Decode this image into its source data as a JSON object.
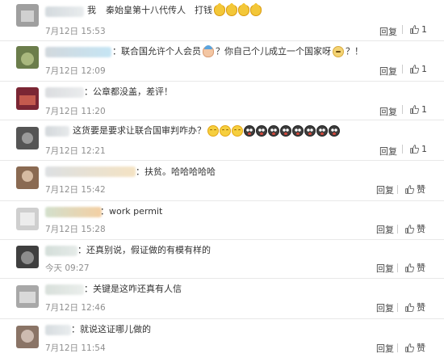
{
  "comments": [
    {
      "text_prefix": "我",
      "text": "秦始皇第十八代传人　打钱",
      "emojis": [
        "cat",
        "cat",
        "cat",
        "cat"
      ],
      "time": "7月12日 15:53",
      "reply_label": "回复",
      "like_count": "1",
      "avatar_colors": [
        "#9f9f9f",
        "#d0d0d0"
      ],
      "name_colors": [
        "#c9d1d6",
        "#e4e8ea"
      ]
    },
    {
      "text": "：联合国允许个人会员",
      "text_after": "？你自己个儿成立一个国家呀",
      "text_end": "？！",
      "emoji_mid": "baby",
      "emoji_end": "doge",
      "time": "7月12日 12:09",
      "reply_label": "回复",
      "like_count": "1",
      "avatar_colors": [
        "#6b7d4b",
        "#a9b87e"
      ],
      "name_colors": [
        "#c7cfd5",
        "#b8dff2"
      ]
    },
    {
      "text": "：公章都没盖，差评！",
      "time": "7月12日 11:20",
      "reply_label": "回复",
      "like_count": "1",
      "avatar_colors": [
        "#7b2634",
        "#c45a4e"
      ],
      "name_colors": [
        "#d2d5d8",
        "#e6e8ea"
      ]
    },
    {
      "text": "这货要是要求让联合国审判咋办？",
      "emojis": [
        "laugh",
        "laugh",
        "laugh",
        "shock",
        "shock",
        "shock",
        "shock",
        "shock",
        "shock",
        "shock",
        "shock"
      ],
      "time": "7月12日 12:21",
      "reply_label": "回复",
      "like_count": "1",
      "avatar_colors": [
        "#555555",
        "#9b9b9b"
      ],
      "name_colors": [
        "#c9cfd3",
        "#e2e5e7"
      ]
    },
    {
      "text": "：扶贫。哈哈哈哈哈",
      "time": "7月12日 15:42",
      "reply_label": "回复",
      "like_label": "赞",
      "avatar_colors": [
        "#8a6a52",
        "#d6bba2"
      ],
      "name_colors": [
        "#d5d9dc",
        "#f2dcb5"
      ]
    },
    {
      "text": "：work permit",
      "time": "7月12日 15:28",
      "reply_label": "回复",
      "like_label": "赞",
      "avatar_colors": [
        "#cfcfcf",
        "#ececec"
      ],
      "name_colors": [
        "#c8d8c0",
        "#f1c48d"
      ]
    },
    {
      "text": "：还真别说，假证做的有模有样的",
      "time": "今天 09:27",
      "reply_label": "回复",
      "like_label": "赞",
      "avatar_colors": [
        "#3f3f3f",
        "#8d8d8d"
      ],
      "name_colors": [
        "#c9d6d0",
        "#e0e7e4"
      ]
    },
    {
      "text": "：关键是这咋还真有人信",
      "time": "7月12日 12:46",
      "reply_label": "回复",
      "like_label": "赞",
      "avatar_colors": [
        "#a8a8a8",
        "#d9d9d9"
      ],
      "name_colors": [
        "#cfd8d2",
        "#e6ebe8"
      ]
    },
    {
      "text": "：就说这证哪儿做的",
      "time": "7月12日 11:54",
      "reply_label": "回复",
      "like_label": "赞",
      "avatar_colors": [
        "#8a7466",
        "#cdbbb0"
      ],
      "name_colors": [
        "#cdd4d8",
        "#e5e9eb"
      ]
    }
  ]
}
